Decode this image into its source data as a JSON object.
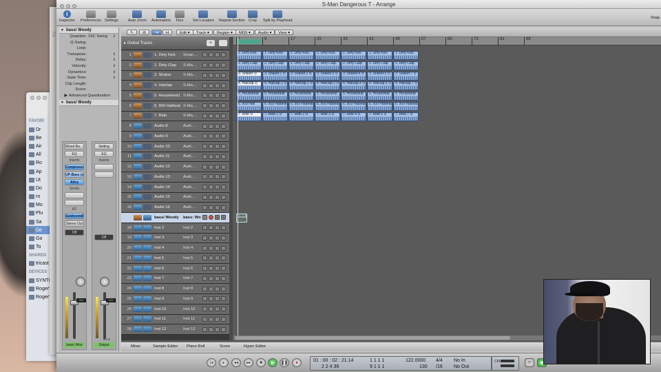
{
  "window": {
    "title": "S-Man Dangerous T - Arrange"
  },
  "toolbar": {
    "items": [
      "Inspector",
      "Preferences",
      "Settings",
      "Auto Zoom",
      "Automation",
      "Flex",
      "Set Locators",
      "Repeat Section",
      "Crop",
      "Split by Playhead"
    ],
    "snap_label": "Snap"
  },
  "finder": {
    "favorites_header": "FAVORI",
    "shared_header": "SHARED",
    "devices_header": "DEVICES",
    "favorites": [
      "Dr",
      "Be",
      "Air",
      "All",
      "Ro",
      "Ap",
      "Ut",
      "Do",
      "ro",
      "Mo",
      "Plu",
      "Sa",
      "De",
      "Go",
      "To"
    ],
    "shared": [
      "tricast"
    ],
    "devices": [
      "SYNTH",
      "Roger'",
      "Roger'"
    ],
    "selected": "De"
  },
  "second_window": {
    "label": "FA"
  },
  "inspector": {
    "region_header": "bass/ Woody",
    "params": [
      {
        "key": "Quantize:",
        "value": "16C Swing"
      },
      {
        "key": "Q-Swing:",
        "value": ""
      },
      {
        "key": "Loop:",
        "value": ""
      },
      {
        "key": "Transpose:",
        "value": ""
      },
      {
        "key": "Delay:",
        "value": ""
      },
      {
        "key": "Velocity:",
        "value": ""
      },
      {
        "key": "Dynamics:",
        "value": ""
      },
      {
        "key": "Gate Time:",
        "value": ""
      },
      {
        "key": "Clip Length:",
        "value": ""
      },
      {
        "key": "Score:",
        "value": ""
      }
    ],
    "advanced": "Advanced Quantization",
    "track_header": "bass/ Woody"
  },
  "channel_strips": [
    {
      "setting": "Wood Ba…",
      "eq": "EQ",
      "inserts_label": "Inserts",
      "inserts": [
        "Compresso",
        "UP-Bass (s)",
        "Alloy"
      ],
      "sends_label": "Sends",
      "io_label": "I/O",
      "input": "Subboom8",
      "output": "Stereo Out",
      "automation": "Off",
      "volume": "0.0",
      "name": "bass/ Woo"
    },
    {
      "setting": "Setting",
      "eq": "EQ",
      "inserts_label": "Inserts",
      "automation": "Off",
      "volume": "0.0",
      "bnce": "Bnce",
      "name": "Output"
    }
  ],
  "arrange_menu": [
    "Edit",
    "Track",
    "Region",
    "MIDI",
    "Audio",
    "View"
  ],
  "global_tracks": "Global Tracks",
  "ruler": [
    "1",
    "9",
    "17",
    "25",
    "33",
    "41",
    "49",
    "57",
    "65",
    "73",
    "81",
    "89"
  ],
  "tracks": [
    {
      "num": "1",
      "name": "1. Dirty Kick",
      "inst": "Sman…",
      "type": "audio"
    },
    {
      "num": "2",
      "name": "2. Dirty Clap",
      "inst": "S-Ma…",
      "type": "audio"
    },
    {
      "num": "3",
      "name": "3. Shaker",
      "inst": "S-Ma…",
      "type": "audio"
    },
    {
      "num": "4",
      "name": "4. Hatclap",
      "inst": "S-Ma…",
      "type": "audio"
    },
    {
      "num": "5",
      "name": "5. Housebeat1",
      "inst": "S-Ma…",
      "type": "audio"
    },
    {
      "num": "6",
      "name": "6. 909 Hatbeat",
      "inst": "S-Ma…",
      "type": "audio"
    },
    {
      "num": "7",
      "name": "7. Ride",
      "inst": "S-Ma…",
      "type": "audio"
    },
    {
      "num": "8",
      "name": "Audio 8",
      "inst": "Audi…",
      "type": "empty"
    },
    {
      "num": "9",
      "name": "Audio 9",
      "inst": "Audi…",
      "type": "empty"
    },
    {
      "num": "10",
      "name": "Audio 10",
      "inst": "Audi…",
      "type": "empty"
    },
    {
      "num": "11",
      "name": "Audio 11",
      "inst": "Audi…",
      "type": "empty"
    },
    {
      "num": "12",
      "name": "Audio 12",
      "inst": "Audi…",
      "type": "empty"
    },
    {
      "num": "13",
      "name": "Audio 13",
      "inst": "Audi…",
      "type": "empty"
    },
    {
      "num": "14",
      "name": "Audio 14",
      "inst": "Audi…",
      "type": "empty"
    },
    {
      "num": "15",
      "name": "Audio 15",
      "inst": "Audi…",
      "type": "empty"
    },
    {
      "num": "16",
      "name": "Audio 16",
      "inst": "Audi…",
      "type": "empty"
    },
    {
      "num": "",
      "name": "bass/ Woody",
      "inst": "bass: Wo…",
      "type": "selected"
    },
    {
      "num": "18",
      "name": "Inst 2",
      "inst": "Inst 2",
      "type": "inst"
    },
    {
      "num": "19",
      "name": "Inst 3",
      "inst": "Inst 3",
      "type": "inst"
    },
    {
      "num": "20",
      "name": "Inst 4",
      "inst": "Inst 4",
      "type": "inst"
    },
    {
      "num": "21",
      "name": "Inst 5",
      "inst": "Inst 5",
      "type": "inst"
    },
    {
      "num": "22",
      "name": "Inst 6",
      "inst": "Inst 6",
      "type": "inst"
    },
    {
      "num": "23",
      "name": "Inst 7",
      "inst": "Inst 7",
      "type": "inst"
    },
    {
      "num": "24",
      "name": "Inst 8",
      "inst": "Inst 8",
      "type": "inst"
    },
    {
      "num": "25",
      "name": "Inst 9",
      "inst": "Inst 9",
      "type": "inst"
    },
    {
      "num": "26",
      "name": "Inst 10",
      "inst": "Inst 10",
      "type": "inst"
    },
    {
      "num": "27",
      "name": "Inst 11",
      "inst": "Inst 11",
      "type": "inst"
    },
    {
      "num": "28",
      "name": "Inst 12",
      "inst": "Inst 12",
      "type": "inst"
    }
  ],
  "regions": [
    [
      "1. Dirty Kick",
      "1. Dirty Kick.",
      "1. Dirty Kick.",
      "1. Dirty Kick.",
      "1. Dirty Kick.",
      "1. Dirty Kick.",
      "1. Dirty Kick."
    ],
    [
      "2. Dirty Clap.",
      "2. Dirty Clap.",
      "2. Dirty Clap.",
      "2. Dirty Clap.",
      "2. Dirty Clap.",
      "2. Dirty Clap.",
      "2. Dirty Clap."
    ],
    [
      "3. Shaker ⊙",
      "3. Shaker.1 ⊙",
      "3. Shaker.2 ⊙",
      "3. Shaker.3 ⊙",
      "3. Shaker.4 ⊙",
      "3. Shaker.5 ⊙",
      "3. Shaker.7 ⊙"
    ],
    [
      "4. Hatclap ⊙",
      "4. Hatclap.1 ⊙",
      "4. Hatclap.2 ⊙",
      "4. Hatclap.3 ⊙",
      "4. Hatclap.4 ⊙",
      "4. Hatclap.5 ⊙",
      "4. Hatclap.7 ⊙"
    ],
    [
      "5. Housebeat",
      "5. Housebeat",
      "5. Housebeat",
      "5. Housebeat",
      "5. Housebeat",
      "5. Housebeat",
      "5. Housebeat"
    ],
    [
      "6. 909 Hati",
      "6. 909 Hatbeat",
      "6. 909 Hatbeat",
      "6. 909 Hatbeat",
      "6. 909 Hatbeat",
      "6. 909 Hatbeat",
      "6. 909 Hatbeat"
    ],
    [
      "7. Ride ⊙",
      "7. Ride.1 ⊙",
      "7. Ride.2 ⊙",
      "7. Ride.3 ⊙",
      "7. Ride.4 ⊙",
      "7. Ride.6 ⊙",
      "7. Ride.7 ⊙"
    ]
  ],
  "bass_region": "bass",
  "bottom_tabs": [
    "Mixer",
    "Sample Editor",
    "Piano Roll",
    "Score",
    "Hyper Editor"
  ],
  "transport": {
    "smpte": "01 : 00 : 02 : 21.14",
    "bars": "2   2   4   39",
    "pos1": "1   1   1      1",
    "pos2": "9   1   1      1",
    "tempo": "122.0000",
    "tempo2": "130",
    "sig": "4/4",
    "div": "/16",
    "in": "No In",
    "out": "No Out",
    "cpu": "CPU"
  }
}
